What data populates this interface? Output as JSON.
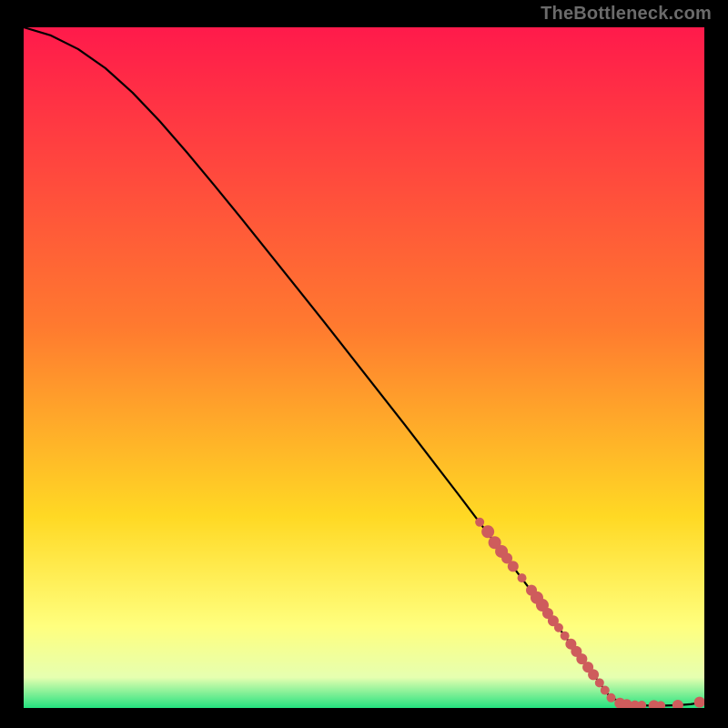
{
  "watermark": "TheBottleneck.com",
  "colors": {
    "bg": "#000000",
    "curve": "#000000",
    "dot_fill": "#ce5c5c",
    "dot_stroke": "#a94a4a",
    "grad_top": "#ff1a4b",
    "grad_mid1": "#ff7a2f",
    "grad_mid2": "#ffd924",
    "grad_mid3": "#ffff7e",
    "grad_mid4": "#e6ffb0",
    "grad_bottom": "#24e27f"
  },
  "chart_data": {
    "type": "line",
    "title": "",
    "xlabel": "",
    "ylabel": "",
    "xlim": [
      0,
      100
    ],
    "ylim": [
      0,
      100
    ],
    "grid": false,
    "legend": false,
    "series": [
      {
        "name": "curve",
        "x": [
          0,
          4,
          8,
          12,
          16,
          20,
          24,
          28,
          32,
          36,
          40,
          44,
          48,
          52,
          56,
          60,
          64,
          68,
          72,
          76,
          80,
          82,
          84,
          86,
          88,
          90,
          92,
          94,
          96,
          98,
          100
        ],
        "y": [
          100,
          98.8,
          96.8,
          94.0,
          90.4,
          86.2,
          81.6,
          76.8,
          71.9,
          66.9,
          61.9,
          56.9,
          51.8,
          46.7,
          41.6,
          36.4,
          31.2,
          25.9,
          20.6,
          15.3,
          9.9,
          7.2,
          4.5,
          1.8,
          0.6,
          0.4,
          0.35,
          0.35,
          0.4,
          0.55,
          0.9
        ]
      }
    ],
    "scatter": [
      {
        "x": 67.0,
        "y": 27.3,
        "r": 5
      },
      {
        "x": 68.2,
        "y": 25.9,
        "r": 7
      },
      {
        "x": 69.2,
        "y": 24.3,
        "r": 7
      },
      {
        "x": 70.2,
        "y": 23.0,
        "r": 7
      },
      {
        "x": 71.0,
        "y": 22.0,
        "r": 6
      },
      {
        "x": 71.9,
        "y": 20.8,
        "r": 6
      },
      {
        "x": 73.2,
        "y": 19.1,
        "r": 5
      },
      {
        "x": 74.6,
        "y": 17.3,
        "r": 6
      },
      {
        "x": 75.4,
        "y": 16.2,
        "r": 7
      },
      {
        "x": 76.2,
        "y": 15.1,
        "r": 7
      },
      {
        "x": 77.0,
        "y": 13.9,
        "r": 6
      },
      {
        "x": 77.8,
        "y": 12.8,
        "r": 6
      },
      {
        "x": 78.6,
        "y": 11.8,
        "r": 5
      },
      {
        "x": 79.5,
        "y": 10.6,
        "r": 5
      },
      {
        "x": 80.4,
        "y": 9.4,
        "r": 6
      },
      {
        "x": 81.2,
        "y": 8.3,
        "r": 6
      },
      {
        "x": 82.0,
        "y": 7.2,
        "r": 6
      },
      {
        "x": 82.9,
        "y": 6.0,
        "r": 6
      },
      {
        "x": 83.7,
        "y": 4.9,
        "r": 6
      },
      {
        "x": 84.6,
        "y": 3.7,
        "r": 5
      },
      {
        "x": 85.4,
        "y": 2.6,
        "r": 5
      },
      {
        "x": 86.3,
        "y": 1.5,
        "r": 5
      },
      {
        "x": 87.6,
        "y": 0.7,
        "r": 6
      },
      {
        "x": 88.6,
        "y": 0.5,
        "r": 6
      },
      {
        "x": 89.8,
        "y": 0.45,
        "r": 5
      },
      {
        "x": 90.8,
        "y": 0.4,
        "r": 5
      },
      {
        "x": 92.6,
        "y": 0.35,
        "r": 6
      },
      {
        "x": 93.6,
        "y": 0.35,
        "r": 5
      },
      {
        "x": 96.1,
        "y": 0.4,
        "r": 6
      },
      {
        "x": 99.3,
        "y": 0.85,
        "r": 6
      }
    ],
    "gradient_stops": [
      {
        "offset": 0.0,
        "color": "grad_top"
      },
      {
        "offset": 0.44,
        "color": "grad_mid1"
      },
      {
        "offset": 0.72,
        "color": "grad_mid2"
      },
      {
        "offset": 0.88,
        "color": "grad_mid3"
      },
      {
        "offset": 0.955,
        "color": "grad_mid4"
      },
      {
        "offset": 1.0,
        "color": "grad_bottom"
      }
    ]
  }
}
